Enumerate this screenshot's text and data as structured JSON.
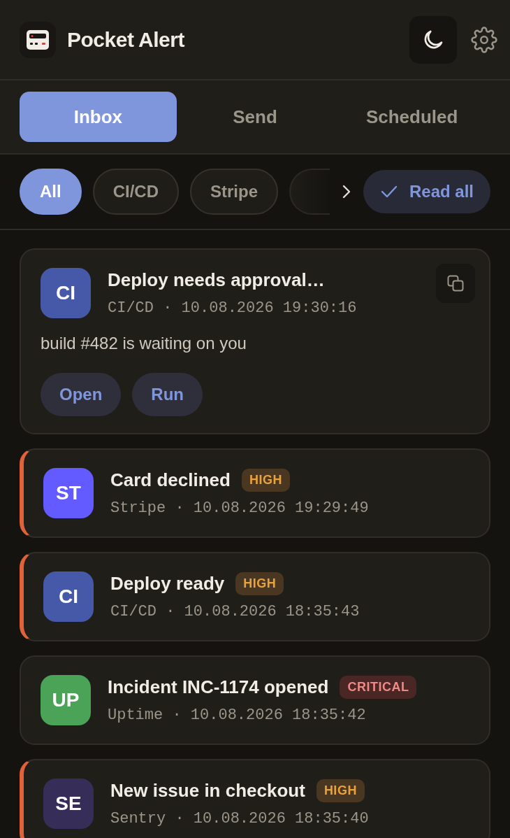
{
  "app": {
    "title": "Pocket Alert"
  },
  "tabs": [
    {
      "label": "Inbox",
      "selected": true
    },
    {
      "label": "Send",
      "selected": false
    },
    {
      "label": "Scheduled",
      "selected": false
    }
  ],
  "filters": [
    {
      "label": "All",
      "selected": true
    },
    {
      "label": "CI/CD",
      "selected": false
    },
    {
      "label": "Stripe",
      "selected": false
    }
  ],
  "read_all": {
    "label": "Read all"
  },
  "notifications": [
    {
      "avatar": "CI",
      "color": "#4659a8",
      "title": "Deploy needs approval…",
      "meta": "CI/CD · 10.08.2026 19:30:16",
      "accent": false,
      "body": "build #482 is waiting on you",
      "actions": [
        "Open",
        "Run"
      ]
    },
    {
      "avatar": "ST",
      "color": "#635bff",
      "title": "Card declined",
      "priority": {
        "label": "HIGH",
        "kind": "high"
      },
      "meta": "Stripe · 10.08.2026 19:29:49",
      "accent": true
    },
    {
      "avatar": "CI",
      "color": "#4659a8",
      "title": "Deploy ready",
      "priority": {
        "label": "HIGH",
        "kind": "high"
      },
      "meta": "CI/CD · 10.08.2026 18:35:43",
      "accent": true
    },
    {
      "avatar": "UP",
      "color": "#4aa357",
      "title": "Incident INC-1174 opened",
      "priority": {
        "label": "CRITICAL",
        "kind": "critical"
      },
      "meta": "Uptime · 10.08.2026 18:35:42",
      "accent": false
    },
    {
      "avatar": "SE",
      "color": "#362d59",
      "title": "New issue in checkout",
      "priority": {
        "label": "HIGH",
        "kind": "high"
      },
      "meta": "Sentry · 10.08.2026 18:35:40",
      "accent": true
    }
  ]
}
